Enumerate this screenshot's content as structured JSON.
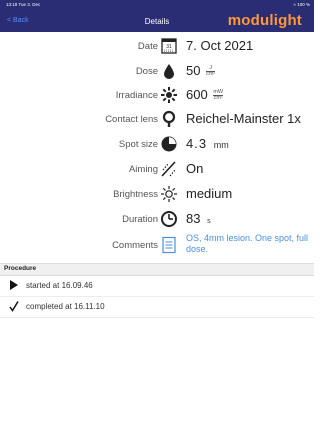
{
  "status_bar": {
    "time": "13:18  Tue 3. Dec",
    "battery": "≈ 100 %"
  },
  "nav": {
    "back_label": "< Back",
    "title": "Details",
    "logo": "modulight"
  },
  "details": [
    {
      "label": "Date",
      "value": "7. Oct 2021",
      "icon": "calendar-icon"
    },
    {
      "label": "Dose",
      "value": "50",
      "unit_num": "J",
      "unit_den": "cm²",
      "icon": "drop-icon"
    },
    {
      "label": "Irradiance",
      "value": "600",
      "unit_num": "mW",
      "unit_den": "cm²",
      "icon": "irradiance-icon"
    },
    {
      "label": "Contact lens",
      "value": "Reichel-Mainster 1x",
      "icon": "lens-icon"
    },
    {
      "label": "Spot size",
      "value": "4.3",
      "unit": "mm",
      "icon": "spot-size-icon"
    },
    {
      "label": "Aiming",
      "value": "On",
      "icon": "aiming-icon"
    },
    {
      "label": "Brightness",
      "value": "medium",
      "icon": "brightness-icon"
    },
    {
      "label": "Duration",
      "value": "83",
      "unit": "s",
      "icon": "clock-icon"
    },
    {
      "label": "Comments",
      "value": "OS, 4mm lesion. One spot, full dose.",
      "icon": "document-icon"
    }
  ],
  "procedure": {
    "title": "Procedure",
    "items": [
      {
        "text": "started at 16.09.46",
        "icon": "play-icon"
      },
      {
        "text": "completed at 16.11.10",
        "icon": "checkmark-icon"
      }
    ]
  }
}
